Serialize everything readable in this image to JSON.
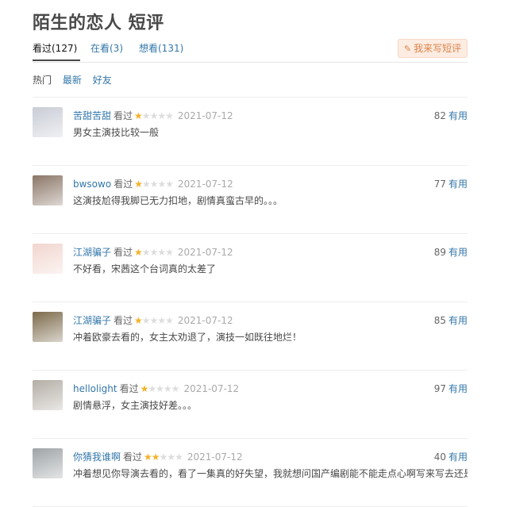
{
  "title": "陌生的恋人 短评",
  "tabs": [
    {
      "label": "看过(127)"
    },
    {
      "label": "在看(3)"
    },
    {
      "label": "想看(131)"
    }
  ],
  "write_button": {
    "icon": "pencil-icon",
    "label": "我来写短评"
  },
  "filters": [
    {
      "label": "热门"
    },
    {
      "label": "最新"
    },
    {
      "label": "好友"
    }
  ],
  "comments": [
    {
      "user": "苦甜苦甜",
      "status": "看过",
      "rating": 1,
      "date": "2021-07-12",
      "votes": "82",
      "useful": "有用",
      "text": "男女主演技比较一般",
      "avatar_color": "#c9ccd6"
    },
    {
      "user": "bwsowo",
      "status": "看过",
      "rating": 1,
      "date": "2021-07-12",
      "votes": "77",
      "useful": "有用",
      "text": "这演技尬得我脚已无力扣地，剧情真蛮古早的。。。",
      "avatar_color": "#8a7566"
    },
    {
      "user": "江湖骗子",
      "status": "看过",
      "rating": 1,
      "date": "2021-07-12",
      "votes": "89",
      "useful": "有用",
      "text": "不好看，宋茜这个台词真的太差了",
      "avatar_color": "#f2d6cf"
    },
    {
      "user": "江湖骗子",
      "status": "看过",
      "rating": 1,
      "date": "2021-07-12",
      "votes": "85",
      "useful": "有用",
      "text": "冲着欧豪去看的，女主太劝退了，演技一如既往地烂！",
      "avatar_color": "#7c6a4b"
    },
    {
      "user": "hellolight",
      "status": "看过",
      "rating": 1,
      "date": "2021-07-12",
      "votes": "97",
      "useful": "有用",
      "text": "剧情悬浮，女主演技好差。。。",
      "avatar_color": "#b3ada5"
    },
    {
      "user": "你猜我谁啊",
      "status": "看过",
      "rating": 2,
      "date": "2021-07-12",
      "votes": "40",
      "useful": "有用",
      "text": "冲着想见你导演去看的，看了一集真的好失望，我就想问国产编剧能不能走点心啊写来写去还是老套路，还",
      "avatar_color": "#9ea3a6"
    }
  ],
  "colors": {
    "link": "#3377aa",
    "star_on": "#f5b22a",
    "star_off": "#dddddd",
    "button_bg": "#fdece1",
    "button_text": "#d9834b"
  }
}
